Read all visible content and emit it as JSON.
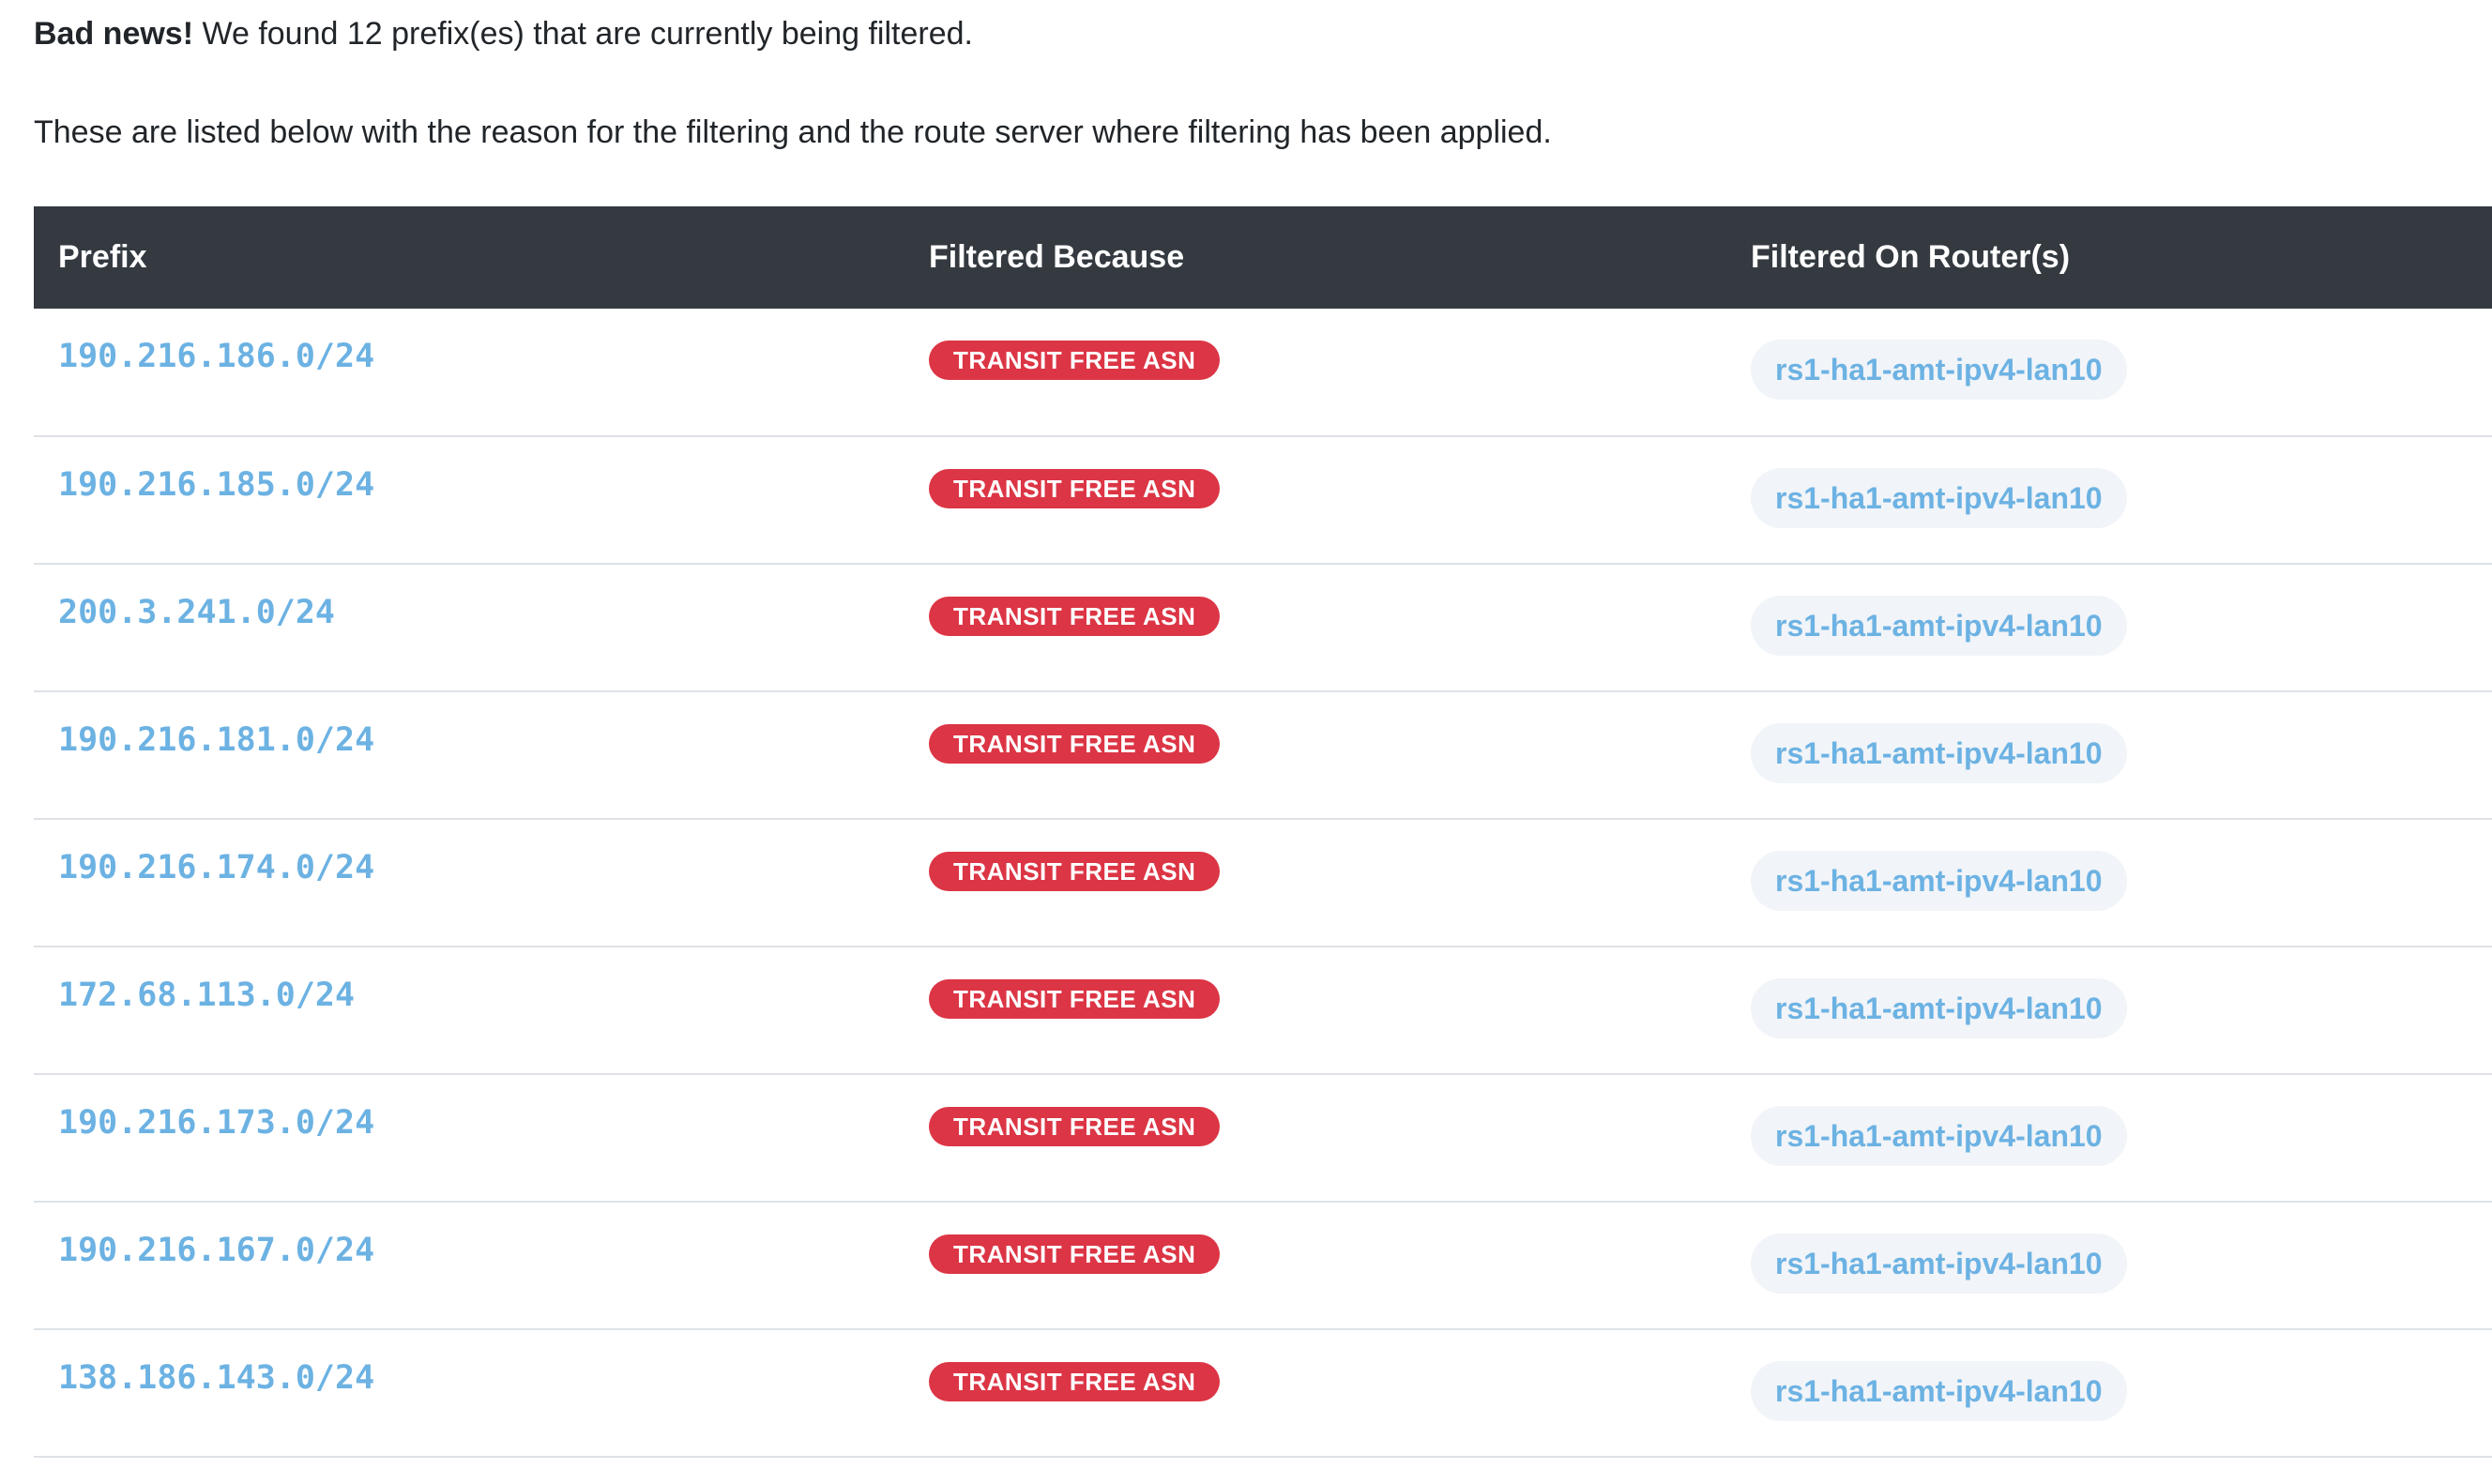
{
  "intro": {
    "bad_news_label": "Bad news!",
    "bad_news_text": " We found 12 prefix(es) that are currently being filtered.",
    "description": "These are listed below with the reason for the filtering and the route server where filtering has been applied."
  },
  "table": {
    "headers": {
      "prefix": "Prefix",
      "reason": "Filtered Because",
      "router": "Filtered On Router(s)"
    },
    "rows": [
      {
        "prefix": "190.216.186.0/24",
        "reason": "TRANSIT FREE ASN",
        "router": "rs1-ha1-amt-ipv4-lan10"
      },
      {
        "prefix": "190.216.185.0/24",
        "reason": "TRANSIT FREE ASN",
        "router": "rs1-ha1-amt-ipv4-lan10"
      },
      {
        "prefix": "200.3.241.0/24",
        "reason": "TRANSIT FREE ASN",
        "router": "rs1-ha1-amt-ipv4-lan10"
      },
      {
        "prefix": "190.216.181.0/24",
        "reason": "TRANSIT FREE ASN",
        "router": "rs1-ha1-amt-ipv4-lan10"
      },
      {
        "prefix": "190.216.174.0/24",
        "reason": "TRANSIT FREE ASN",
        "router": "rs1-ha1-amt-ipv4-lan10"
      },
      {
        "prefix": "172.68.113.0/24",
        "reason": "TRANSIT FREE ASN",
        "router": "rs1-ha1-amt-ipv4-lan10"
      },
      {
        "prefix": "190.216.173.0/24",
        "reason": "TRANSIT FREE ASN",
        "router": "rs1-ha1-amt-ipv4-lan10"
      },
      {
        "prefix": "190.216.167.0/24",
        "reason": "TRANSIT FREE ASN",
        "router": "rs1-ha1-amt-ipv4-lan10"
      },
      {
        "prefix": "138.186.143.0/24",
        "reason": "TRANSIT FREE ASN",
        "router": "rs1-ha1-amt-ipv4-lan10"
      }
    ]
  },
  "colors": {
    "header_bg": "#343a40",
    "prefix_link": "#6cb2e3",
    "badge_danger": "#dc3545",
    "router_pill_bg": "#f1f4f8"
  }
}
